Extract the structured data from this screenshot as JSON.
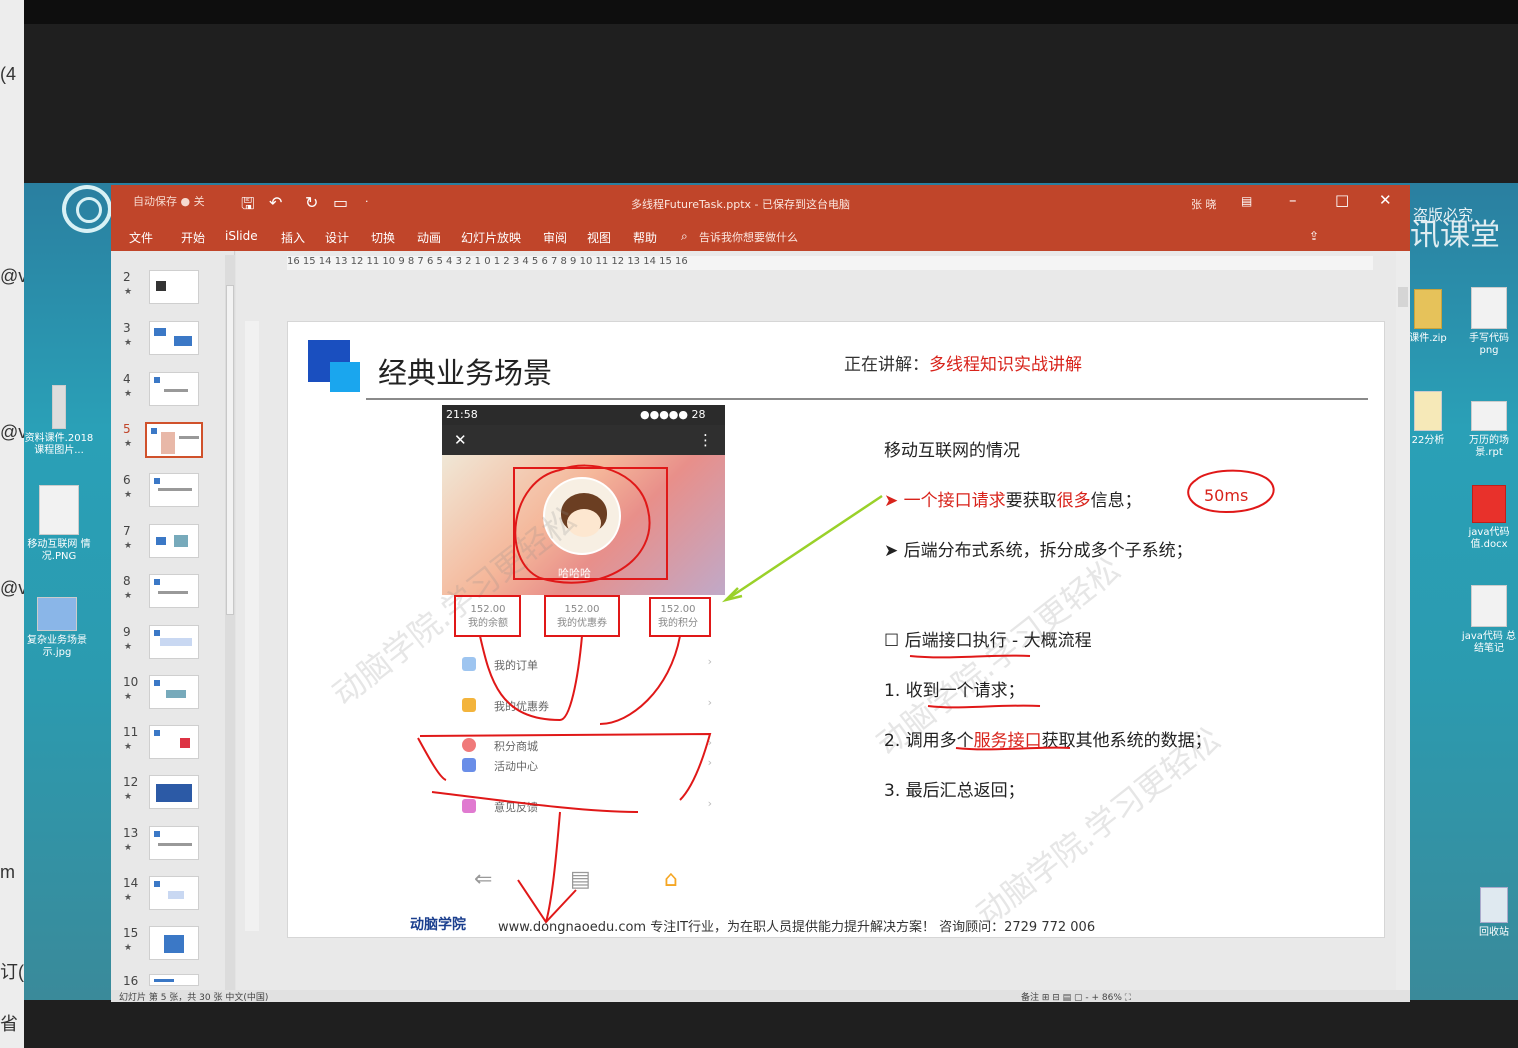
{
  "left_strip": {
    "line1": "(4",
    "line2": "@v",
    "line3": "@v",
    "line4": "@v",
    "line5": "m",
    "line6": "订(",
    "line7": "省"
  },
  "desktop_left": [
    {
      "label": "资料课件.2018\n课程图片..."
    },
    {
      "label": "移动互联网\n情况.PNG"
    },
    {
      "label": "复杂业务场景\n示.jpg"
    }
  ],
  "desktop_right": [
    {
      "label": "课件.zip"
    },
    {
      "label": "手写代码\npng"
    },
    {
      "label": "22分析"
    },
    {
      "label": "万历的场\n景.rpt"
    },
    {
      "label": "java代码\n值.docx"
    },
    {
      "label": "java代码\n总结笔记"
    },
    {
      "label": "回收站"
    }
  ],
  "brand": {
    "name": "腾讯课堂",
    "notice": "盗版必究"
  },
  "ppt": {
    "autosave": "自动保存 ● 关",
    "document_title": "多线程FutureTask.pptx - 已保存到这台电脑",
    "user": "张 晓",
    "tabs": [
      "文件",
      "开始",
      "iSlide",
      "插入",
      "设计",
      "切换",
      "动画",
      "幻灯片放映",
      "审阅",
      "视图",
      "帮助"
    ],
    "tell_me": "告诉我你想要做什么",
    "ruler": "16 15 14 13 12 11 10 9 8 7 6 5 4 3 2 1 0 1 2 3 4 5 6 7 8 9 10 11 12 13 14 15 16",
    "thumb_numbers": [
      "2",
      "3",
      "4",
      "5",
      "6",
      "7",
      "8",
      "9",
      "10",
      "11",
      "12",
      "13",
      "14",
      "15",
      "16"
    ],
    "active_slide": "5",
    "status_left": "幻灯片 第 5 张，共 30 张    中文(中国)",
    "status_right": "备注    ⊞  ⊟  ▤  ▢  -   +  86%  ⛶"
  },
  "slide": {
    "title": "经典业务场景",
    "speaking_label": "正在讲解：",
    "speaking_topic": "多线程知识实战讲解",
    "phone": {
      "time": "21:58",
      "status_right": "●●●●● 28",
      "close_icon": "✕",
      "menu_icon": "⋮",
      "name": "哈哈哈",
      "stats": [
        {
          "value": "152.00",
          "label": "我的余额"
        },
        {
          "value": "152.00",
          "label": "我的优惠券"
        },
        {
          "value": "152.00",
          "label": "我的积分"
        }
      ],
      "rows": [
        "我的订单",
        "我的优惠券",
        "积分商城",
        "活动中心",
        "意见反馈"
      ]
    },
    "section_heading": "移动互联网的情况",
    "bullet1_pre": "一个接口",
    "bullet1_red1": "请求",
    "bullet1_mid": "要获取",
    "bullet1_red2": "很多",
    "bullet1_post": "信息；",
    "annotation": "50ms",
    "bullet2": "后端分布式系统，拆分成多个子系统；",
    "flow_heading": "后端接口执行 - 大概流程",
    "step1": "1.  收到一个请求；",
    "step2_pre": "2.  调用多个",
    "step2_red": "服务接口",
    "step2_post": "获取其他系统的数据；",
    "step3": "3.  最后汇总返回；",
    "footer_logo": "动脑学院",
    "footer_text": "www.dongnaoedu.com  专注IT行业，为在职人员提供能力提升解决方案！ 咨询顾问：2729 772 006",
    "watermark": "动脑学院.学习更轻松"
  },
  "colors": {
    "ribbon": "#c0452a",
    "accent_red": "#d8231b",
    "ink_red": "#e01818",
    "arrow_green": "#9ad12a"
  }
}
